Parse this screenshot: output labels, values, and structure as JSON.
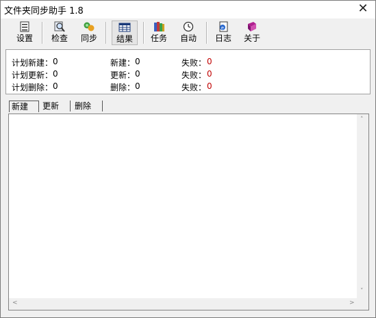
{
  "window": {
    "title": "文件夹同步助手 1.8",
    "close_glyph": "✕"
  },
  "toolbar": {
    "settings": "设置",
    "check": "检查",
    "sync": "同步",
    "results": "结果",
    "tasks": "任务",
    "auto": "自动",
    "log": "日志",
    "about": "关于"
  },
  "stats": {
    "planned_new_label": "计划新建：",
    "planned_new_value": "0",
    "planned_update_label": "计划更新：",
    "planned_update_value": "0",
    "planned_delete_label": "计划删除：",
    "planned_delete_value": "0",
    "new_label": "新建：",
    "new_value": "0",
    "update_label": "更新：",
    "update_value": "0",
    "delete_label": "删除：",
    "delete_value": "0",
    "fail_label": "失败：",
    "fail_new_value": "0",
    "fail_update_value": "0",
    "fail_delete_value": "0"
  },
  "tabs": [
    "新建",
    "更新",
    "删除"
  ],
  "scroll": {
    "up": "˄",
    "down": "˅",
    "left": "<",
    "right": ">"
  },
  "colors": {
    "fail": "#c00000"
  }
}
